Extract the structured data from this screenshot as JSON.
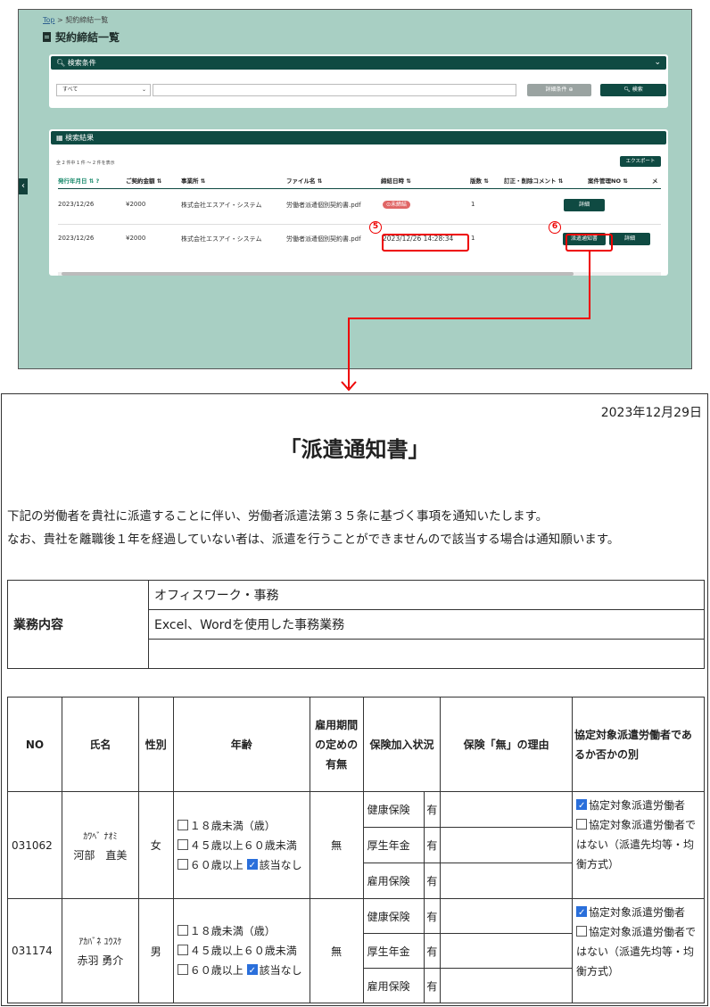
{
  "app": {
    "breadcrumb": {
      "home": "Top",
      "sep": ">",
      "current": "契約締結一覧"
    },
    "page_title": "契約締結一覧",
    "search": {
      "header": "検索条件",
      "select_value": "すべて",
      "input_value": "",
      "detail_button": "詳細条件 ⊕",
      "search_button": "検索"
    },
    "results": {
      "header": "検索結果",
      "count_text": "全 2 件中 1 件 〜 2 件を表示",
      "export_button": "エクスポート",
      "columns": [
        "発行年月日",
        "ご契約金額",
        "事業所",
        "ファイル名",
        "締結日時",
        "版数",
        "訂正・削除コメント",
        "案件管理NO",
        "メ"
      ],
      "rows": [
        {
          "date": "2023/12/26",
          "amount": "¥2000",
          "office": "株式会社エスアイ・システム",
          "file": "労働者派遣個別契約書.pdf",
          "concluded": "⊙未締結",
          "version": "1",
          "detail_button": "詳細"
        },
        {
          "date": "2023/12/26",
          "amount": "¥2000",
          "office": "株式会社エスアイ・システム",
          "file": "労働者派遣個別契約書.pdf",
          "concluded": "2023/12/26 14:28:34",
          "version": "1",
          "notice_button": "派遣通知書",
          "detail_button": "詳細"
        }
      ]
    },
    "markers": {
      "five": "5",
      "six": "6"
    }
  },
  "document": {
    "date": "2023年12月29日",
    "title": "「派遣通知書」",
    "intro_1": "下記の労働者を貴社に派遣することに伴い、労働者派遣法第３５条に基づく事項を通知いたします。",
    "intro_2": "なお、貴社を離職後１年を経過していない者は、派遣を行うことができませんので該当する場合は通知願います。",
    "business": {
      "label": "業務内容",
      "lines": [
        "オフィスワーク・事務",
        "Excel、Wordを使用した事務業務",
        ""
      ]
    },
    "table_headers": {
      "no": "NO",
      "name": "氏名",
      "sex": "性別",
      "age": "年齢",
      "term": "雇用期間の定めの有無",
      "insurance": "保険加入状況",
      "reason": "保険「無」の理由",
      "agreement": "協定対象派遣労働者であるか否かの別"
    },
    "age_options": [
      "１８歳未満（歳）",
      "４５歳以上６０歳未満",
      "６０歳以上",
      "該当なし"
    ],
    "insurance_types": [
      "健康保険",
      "厚生年金",
      "雇用保険"
    ],
    "agreement_options": [
      "協定対象派遣労働者",
      "協定対象派遣労働者ではない（派遣先均等・均衡方式）"
    ],
    "workers": [
      {
        "no": "031062",
        "kana": "ｶﾜﾍﾞ ﾅｵﾐ",
        "name": "河部　直美",
        "sex": "女",
        "term": "無",
        "insurance": [
          "有",
          "有",
          "有"
        ]
      },
      {
        "no": "031174",
        "kana": "ｱｶﾊﾞﾈ ﾕｳｽｹ",
        "name": "赤羽 勇介",
        "sex": "男",
        "term": "無",
        "insurance": [
          "有",
          "有",
          "有"
        ]
      }
    ]
  }
}
